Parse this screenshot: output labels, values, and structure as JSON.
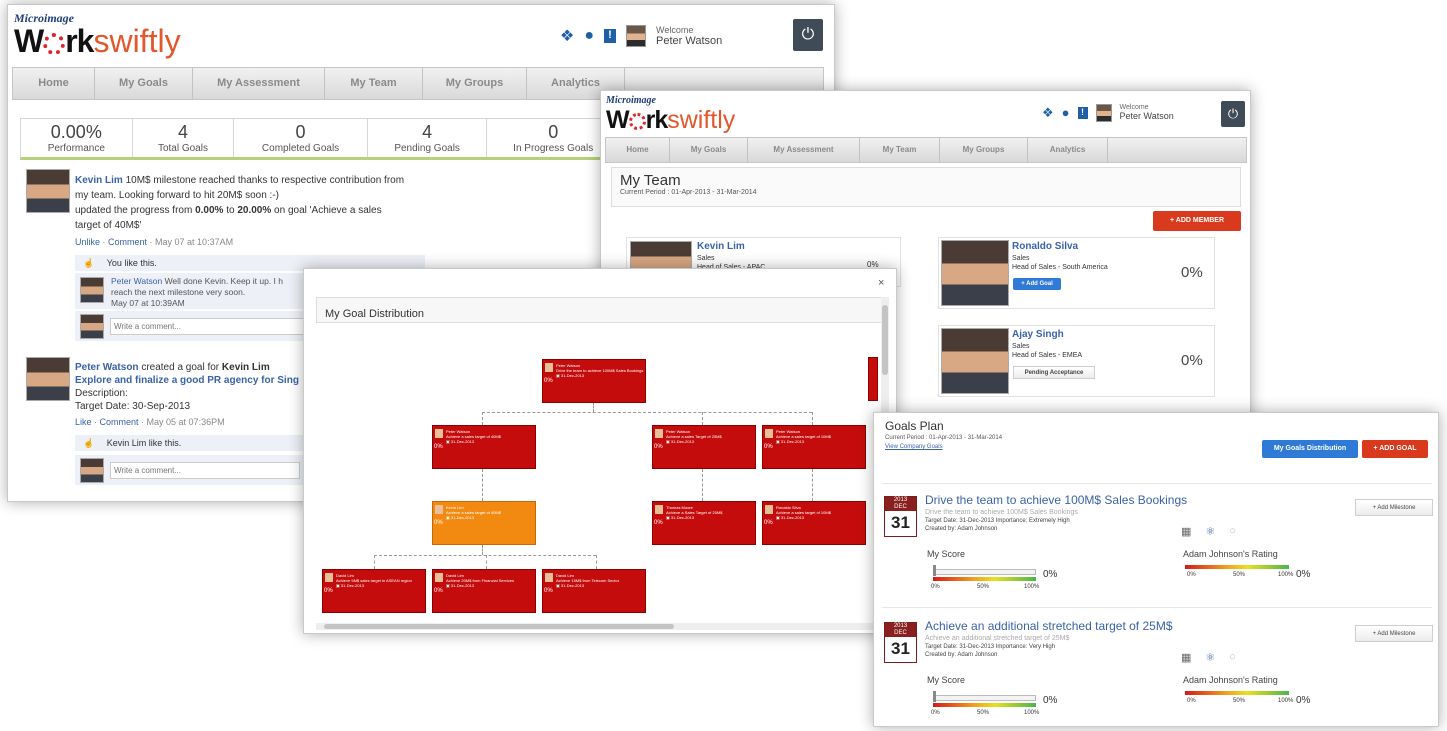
{
  "app": {
    "brand_small": "Microimage",
    "brand_work": "W",
    "brand_rk": "rk",
    "brand_swiftly": "swiftly"
  },
  "header": {
    "welcome": "Welcome",
    "user": "Peter Watson",
    "icons": [
      "people-icon",
      "chat-icon",
      "alert-icon",
      "power-icon"
    ]
  },
  "nav": {
    "items": [
      "Home",
      "My Goals",
      "My Assessment",
      "My Team",
      "My Groups",
      "Analytics"
    ]
  },
  "stats": [
    {
      "value": "0.00%",
      "label": "Performance"
    },
    {
      "value": "4",
      "label": "Total Goals"
    },
    {
      "value": "0",
      "label": "Completed Goals"
    },
    {
      "value": "4",
      "label": "Pending Goals"
    },
    {
      "value": "0",
      "label": "In Progress Goals"
    }
  ],
  "feed": {
    "post1": {
      "author": "Kevin Lim",
      "line1": "10M$ milestone reached thanks to respective contribution from",
      "line2": "my team. Looking forward to hit 20M$ soon :-)",
      "line3a": "updated the progress from",
      "from": "0.00%",
      "to_word": "to",
      "to": "20.00%",
      "line3b": "on goal 'Achieve a sales",
      "line4": "target of 40M$'",
      "actions": [
        "Unlike",
        "Comment"
      ],
      "time": "May 07 at 10:37AM",
      "likes": "You like this.",
      "comment_author": "Peter Watson",
      "comment_text": "Well done Kevin. Keep it up. I h",
      "comment_text2": "reach the next milestone very soon.",
      "comment_time": "May 07 at 10:39AM",
      "write_placeholder": "Write a comment..."
    },
    "post2": {
      "author": "Peter Watson",
      "verb": "created a goal for",
      "target": "Kevin Lim",
      "goal": "Explore and finalize a good PR agency for Sing",
      "desc": "Description:",
      "date": "Target Date: 30-Sep-2013",
      "actions": [
        "Like",
        "Comment"
      ],
      "time": "May 05 at 07:36PM",
      "likes": "Kevin Lim like this.",
      "write_placeholder": "Write a comment..."
    }
  },
  "team": {
    "title": "My Team",
    "period": "Current Period : 01-Apr-2013 - 31-Mar-2014",
    "add_member": "+ ADD MEMBER",
    "members": [
      {
        "name": "Kevin Lim",
        "dept": "Sales",
        "role": "Head of Sales - APAC",
        "pct": "0%"
      },
      {
        "name": "Ronaldo Silva",
        "dept": "Sales",
        "role": "Head of Sales - South America",
        "pct": "0%",
        "action": "+ Add Goal"
      },
      {
        "name": "Ajay Singh",
        "dept": "Sales",
        "role": "Head of Sales - EMEA",
        "pct": "0%",
        "action": "Pending Acceptance"
      }
    ]
  },
  "distribution": {
    "title": "My Goal Distribution",
    "close": "×",
    "nodes": [
      {
        "name": "Peter Watson",
        "goal": "Drive the team to achieve 100M$ Sales Bookings",
        "date": "31-Dec-2013",
        "pct": "0%"
      },
      {
        "name": "Peter Watson",
        "goal": "Achieve a sales target of 40M$",
        "date": "31-Dec-2013",
        "pct": "0%"
      },
      {
        "name": "Peter Watson",
        "goal": "Achieve a sales Target of 25M$",
        "date": "31-Dec-2013",
        "pct": "0%"
      },
      {
        "name": "Peter Watson",
        "goal": "Achieve a sales target of 10M$",
        "date": "31-Dec-2013",
        "pct": "0%"
      },
      {
        "name": "Kevin Lim",
        "goal": "Achieve a sales target of 40M$",
        "date": "31-Dec-2013",
        "pct": "0%"
      },
      {
        "name": "Thomas Moore",
        "goal": "Achieve a Sales Target of 25M$",
        "date": "31-Dec-2013",
        "pct": "0%"
      },
      {
        "name": "Ronaldo Silva",
        "goal": "Achieve a sales target of 10M$",
        "date": "31-Dec-2013",
        "pct": "0%"
      },
      {
        "name": "David Lim",
        "goal": "Achieve 5M$ sales target in ASEAN region",
        "date": "31-Dec-2013",
        "pct": "0%"
      },
      {
        "name": "David Lim",
        "goal": "Achieve 20M$ from Financial Services",
        "date": "31-Dec-2013",
        "pct": "0%"
      },
      {
        "name": "David Lim",
        "goal": "Achieve 15M$ from Telecom Sector",
        "date": "31-Dec-2013",
        "pct": "0%"
      }
    ]
  },
  "goals": {
    "title": "Goals Plan",
    "period": "Current Period : 01-Apr-2013 - 31-Mar-2014",
    "view_company": "View Company Goals",
    "btn_dist": "My Goals Distribution",
    "btn_add": "+ ADD GOAL",
    "score_label": "My Score",
    "rating_label": "Adam Johnson's Rating",
    "scale": [
      "0%",
      "50%",
      "100%"
    ],
    "add_milestone": "+ Add Milestone",
    "items": [
      {
        "year": "2013",
        "month": "DEC",
        "day": "31",
        "title": "Drive the team to achieve 100M$ Sales Bookings",
        "sub": "Drive the team to achieve 100M$ Sales Bookings",
        "meta": "Target Date: 31-Dec-2013  Importance: Extremely High",
        "created": "Created by:  Adam Johnson",
        "score": "0%",
        "rating": "0%"
      },
      {
        "year": "2013",
        "month": "DEC",
        "day": "31",
        "title": "Achieve an additional stretched target of 25M$",
        "sub": "Achieve an additional stretched target of 25M$",
        "meta": "Target Date: 31-Dec-2013  Importance: Very High",
        "created": "Created by:  Adam Johnson",
        "score": "0%",
        "rating": "0%"
      }
    ]
  }
}
